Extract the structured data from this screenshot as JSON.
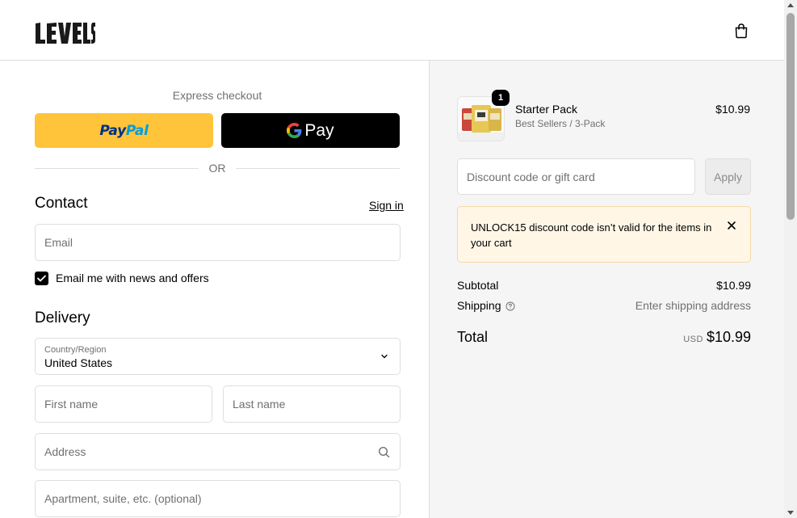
{
  "header": {
    "logo_text": "LEVELS",
    "cart_icon": "shopping-bag-icon"
  },
  "express": {
    "title": "Express checkout",
    "paypal_pay": "Pay",
    "paypal_pal": "Pal",
    "gpay_label": "Pay",
    "or_text": "OR"
  },
  "contact": {
    "title": "Contact",
    "signin": "Sign in",
    "email_placeholder": "Email",
    "newsletter_label": "Email me with news and offers",
    "newsletter_checked": true
  },
  "delivery": {
    "title": "Delivery",
    "country_label": "Country/Region",
    "country_value": "United States",
    "first_name_placeholder": "First name",
    "last_name_placeholder": "Last name",
    "address_placeholder": "Address",
    "apartment_placeholder": "Apartment, suite, etc. (optional)"
  },
  "order": {
    "item": {
      "name": "Starter Pack",
      "variant": "Best Sellers / 3-Pack",
      "price": "$10.99",
      "quantity": "1"
    },
    "discount_placeholder": "Discount code or gift card",
    "apply_label": "Apply",
    "alert_message": "UNLOCK15 discount code isn’t valid for the items in your cart",
    "subtotal_label": "Subtotal",
    "subtotal_value": "$10.99",
    "shipping_label": "Shipping",
    "shipping_value": "Enter shipping address",
    "total_label": "Total",
    "currency": "USD",
    "total_value": "$10.99"
  },
  "colors": {
    "paypal_yellow": "#ffc439",
    "paypal_dark_blue": "#003087",
    "paypal_light_blue": "#009cde",
    "alert_bg": "#fff6e6",
    "summary_bg": "#f5f5f5"
  }
}
